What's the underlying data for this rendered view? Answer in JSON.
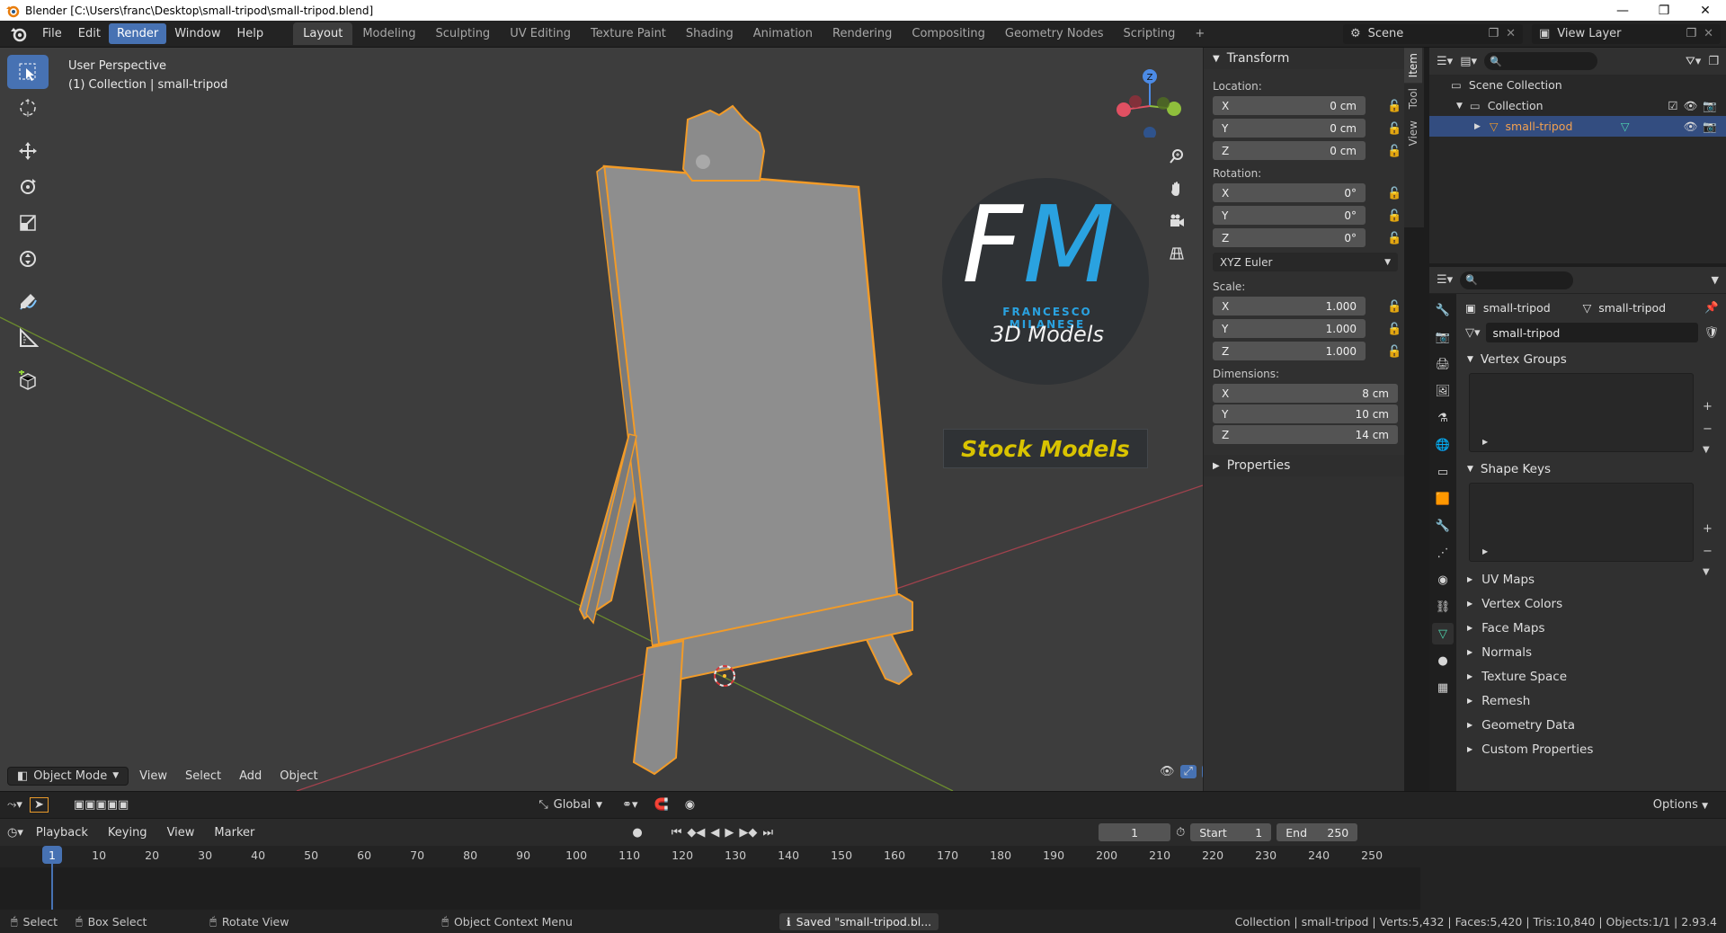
{
  "window": {
    "title": "Blender [C:\\Users\\franc\\Desktop\\small-tripod\\small-tripod.blend]"
  },
  "menu": {
    "items": [
      "File",
      "Edit",
      "Render",
      "Window",
      "Help"
    ],
    "active": "Render"
  },
  "workspaces": {
    "tabs": [
      "Layout",
      "Modeling",
      "Sculpting",
      "UV Editing",
      "Texture Paint",
      "Shading",
      "Animation",
      "Rendering",
      "Compositing",
      "Geometry Nodes",
      "Scripting"
    ],
    "active": "Layout",
    "add_label": "+"
  },
  "scene": {
    "label": "Scene",
    "view_layer": "View Layer"
  },
  "viewport": {
    "perspective": "User Perspective",
    "collection_info": "(1) Collection | small-tripod",
    "mode": "Object Mode",
    "menus": [
      "View",
      "Select",
      "Add",
      "Object"
    ],
    "transform_orientation": "Global",
    "options_label": "Options",
    "gizmo_axis": "Z"
  },
  "logo": {
    "f": "F",
    "m": "M",
    "name": "FRANCESCO MILANESE",
    "subtitle": "3D Models",
    "stock": "Stock Models"
  },
  "npanel": {
    "tabs": [
      "Item",
      "Tool",
      "View"
    ],
    "transform_title": "Transform",
    "location_label": "Location:",
    "location": [
      {
        "axis": "X",
        "value": "0 cm"
      },
      {
        "axis": "Y",
        "value": "0 cm"
      },
      {
        "axis": "Z",
        "value": "0 cm"
      }
    ],
    "rotation_label": "Rotation:",
    "rotation": [
      {
        "axis": "X",
        "value": "0°"
      },
      {
        "axis": "Y",
        "value": "0°"
      },
      {
        "axis": "Z",
        "value": "0°"
      }
    ],
    "rotation_mode": "XYZ Euler",
    "scale_label": "Scale:",
    "scale": [
      {
        "axis": "X",
        "value": "1.000"
      },
      {
        "axis": "Y",
        "value": "1.000"
      },
      {
        "axis": "Z",
        "value": "1.000"
      }
    ],
    "dimensions_label": "Dimensions:",
    "dimensions": [
      {
        "axis": "X",
        "value": "8 cm"
      },
      {
        "axis": "Y",
        "value": "10 cm"
      },
      {
        "axis": "Z",
        "value": "14 cm"
      }
    ],
    "properties_label": "Properties"
  },
  "outliner": {
    "scene_collection": "Scene Collection",
    "collection": "Collection",
    "object": "small-tripod"
  },
  "properties": {
    "crumb_object": "small-tripod",
    "crumb_mesh": "small-tripod",
    "mesh_name": "small-tripod",
    "sections_open": [
      "Vertex Groups",
      "Shape Keys"
    ],
    "sections_closed": [
      "UV Maps",
      "Vertex Colors",
      "Face Maps",
      "Normals",
      "Texture Space",
      "Remesh",
      "Geometry Data",
      "Custom Properties"
    ]
  },
  "timeline": {
    "menus": [
      "Playback",
      "Keying",
      "View",
      "Marker"
    ],
    "current_frame": "1",
    "start_label": "Start",
    "start": "1",
    "end_label": "End",
    "end": "250",
    "ticks": [
      "10",
      "20",
      "30",
      "40",
      "50",
      "60",
      "70",
      "80",
      "90",
      "100",
      "110",
      "120",
      "130",
      "140",
      "150",
      "160",
      "170",
      "180",
      "190",
      "200",
      "210",
      "220",
      "230",
      "240",
      "250"
    ],
    "playhead": "1"
  },
  "statusbar": {
    "select": "Select",
    "box_select": "Box Select",
    "rotate_view": "Rotate View",
    "context_menu": "Object Context Menu",
    "saved": "Saved \"small-tripod.bl...",
    "stats": "Collection | small-tripod | Verts:5,432 | Faces:5,420 | Tris:10,840 | Objects:1/1 | 2.93.4"
  },
  "colors": {
    "accent": "#4772b3",
    "selection_outline": "#f29b28",
    "x_axis": "#e05062",
    "y_axis": "#8fbf3c",
    "z_axis": "#4c8be6",
    "logo_blue": "#2aa2e0",
    "logo_yellow": "#d9c300"
  }
}
